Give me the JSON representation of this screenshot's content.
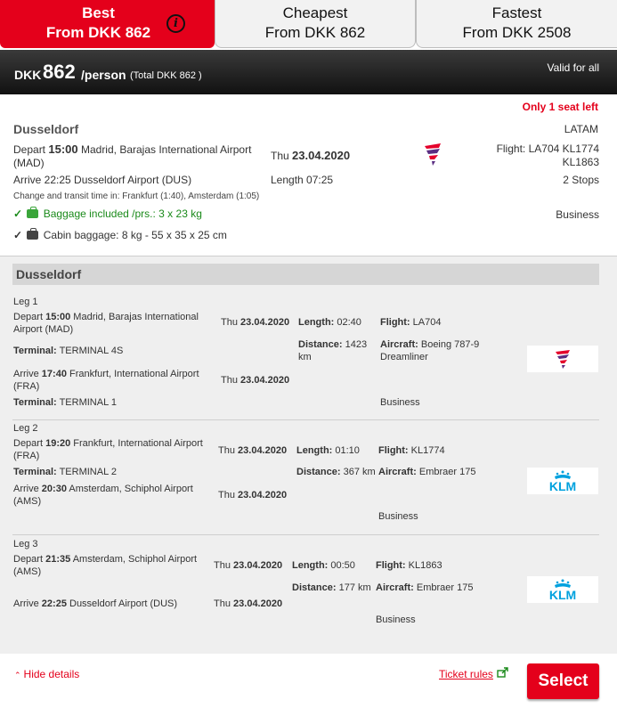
{
  "tabs": {
    "best": {
      "line1": "Best",
      "line2": "From DKK 862"
    },
    "cheapest": {
      "line1": "Cheapest",
      "line2": "From DKK 862"
    },
    "fastest": {
      "line1": "Fastest",
      "line2": "From DKK 2508"
    },
    "info_glyph": "i"
  },
  "price": {
    "currency": "DKK",
    "amount": "862",
    "per": "/person",
    "total": "(Total DKK 862 )",
    "valid": "Valid for all"
  },
  "summary": {
    "seats_left": "Only 1 seat left",
    "destination": "Dusseldorf",
    "airline": "LATAM",
    "depart_label": "Depart",
    "depart_time": "15:00",
    "depart_airport_l1": "Madrid, Barajas International Airport",
    "depart_airport_l2": "(MAD)",
    "date_prefix": "Thu",
    "date": "23.04.2020",
    "flight_label": "Flight:",
    "flights_l1": "LA704 KL1774",
    "flights_l2": "KL1863",
    "arrive_text": "Arrive 22:25 Dusseldorf Airport (DUS)",
    "length_text": "Length 07:25",
    "stops": "2 Stops",
    "transit": "Change and transit time in: Frankfurt (1:40), Amsterdam (1:05)",
    "check_glyph": "✓",
    "baggage": "Baggage included /prs.: 3 x 23 kg",
    "cabin_class": "Business",
    "cabin_baggage": "Cabin baggage: 8 kg - 55 x 35 x 25 cm"
  },
  "details": {
    "title": "Dusseldorf",
    "labels": {
      "depart": "Depart",
      "arrive": "Arrive",
      "terminal": "Terminal:",
      "length": "Length:",
      "distance": "Distance:",
      "flight": "Flight:",
      "aircraft": "Aircraft:",
      "thu": "Thu"
    },
    "legs": [
      {
        "title": "Leg 1",
        "dep_time": "15:00",
        "dep_airport_l1": "Madrid, Barajas International",
        "dep_airport_l2": "Airport (MAD)",
        "dep_date": "23.04.2020",
        "length": "02:40",
        "flight": "LA704",
        "distance_l1": "1423",
        "distance_l2": "km",
        "aircraft_l1": "Boeing 787-9",
        "aircraft_l2": "Dreamliner",
        "dep_terminal": "TERMINAL 4S",
        "arr_time": "17:40",
        "arr_airport_l1": "Frankfurt, International Airport",
        "arr_airport_l2": "(FRA)",
        "arr_date": "23.04.2020",
        "arr_terminal": "TERMINAL 1",
        "cabin": "Business",
        "logo": "latam-logo"
      },
      {
        "title": "Leg 2",
        "dep_time": "19:20",
        "dep_airport_l1": "Frankfurt, International Airport",
        "dep_airport_l2": "(FRA)",
        "dep_date": "23.04.2020",
        "length": "01:10",
        "flight": "KL1774",
        "distance": "367 km",
        "aircraft": "Embraer 175",
        "dep_terminal": "TERMINAL 2",
        "arr_time": "20:30",
        "arr_airport_l1": "Amsterdam, Schiphol Airport",
        "arr_airport_l2": "(AMS)",
        "arr_date": "23.04.2020",
        "cabin": "Business",
        "logo": "klm-logo",
        "logo_text": "KLM"
      },
      {
        "title": "Leg 3",
        "dep_time": "21:35",
        "dep_airport_l1": "Amsterdam, Schiphol Airport",
        "dep_airport_l2": "(AMS)",
        "dep_date": "23.04.2020",
        "length": "00:50",
        "flight": "KL1863",
        "distance": "177 km",
        "aircraft": "Embraer 175",
        "arr_time": "22:25",
        "arr_airport": "Dusseldorf Airport (DUS)",
        "arr_date": "23.04.2020",
        "cabin": "Business",
        "logo": "klm-logo",
        "logo_text": "KLM"
      }
    ]
  },
  "footer": {
    "hide_details": "Hide details",
    "chevron": "⌃",
    "ticket_rules": "Ticket rules",
    "select": "Select"
  },
  "colors": {
    "accent": "#e4001b",
    "header_dark": "#111111",
    "included_green": "#1a8a1a",
    "latam_purple": "#5a2d82",
    "latam_red": "#e4002b",
    "klm_blue": "#00a1de"
  }
}
